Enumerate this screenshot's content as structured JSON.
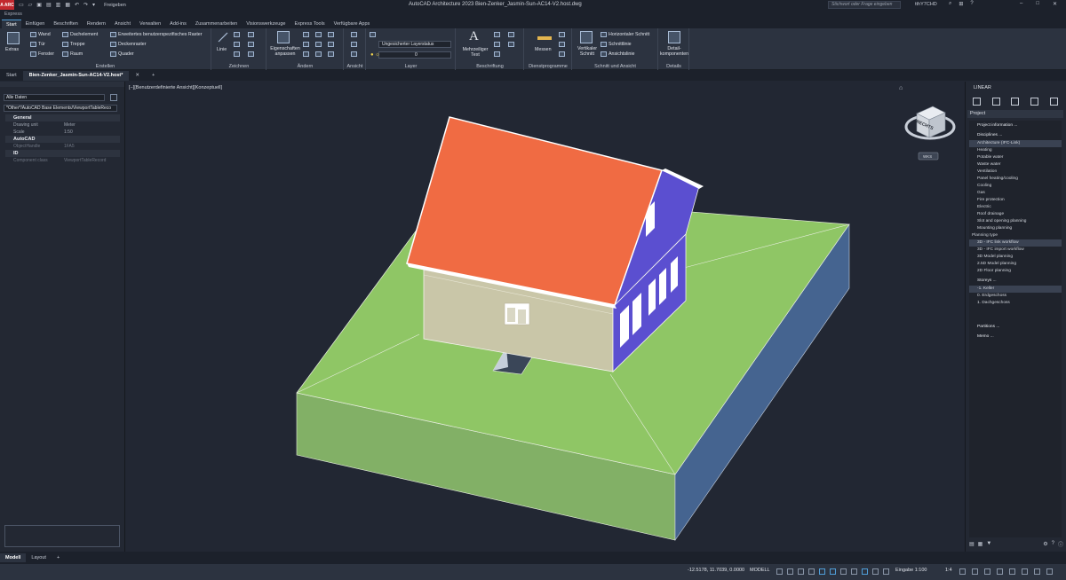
{
  "titlebar": {
    "logo": "A ARC",
    "share": "Freigeben",
    "title": "AutoCAD Architecture 2023   Bien-Zenker_Jasmin-Sun-AC14-V2.host.dwg",
    "search_placeholder": "Stichwort oder Frage eingeben",
    "user": "tthY7CHD"
  },
  "express": "Express",
  "ribbon_tabs": [
    "Start",
    "Einfügen",
    "Beschriften",
    "Rendern",
    "Ansicht",
    "Verwalten",
    "Add-ins",
    "Zusammenarbeiten",
    "Visionswerkzeuge",
    "Express Tools",
    "Verfügbare Apps"
  ],
  "ribbon": {
    "erstellen": {
      "label": "Erstellen",
      "extras": "Extras",
      "items": [
        "Wand",
        "Tür",
        "Fenster",
        "Dachelement",
        "Treppe",
        "Raum",
        "Erweitertes benutzerspezifisches Raster",
        "Deckenraster",
        "Quader"
      ]
    },
    "zeichnen": {
      "label": "Zeichnen",
      "linie": "Linie"
    },
    "aendern": {
      "label": "Ändern",
      "eigenschaften": "Eigenschaften anpassen"
    },
    "ansicht": {
      "label": "Ansicht"
    },
    "layer": {
      "label": "Layer",
      "layerstatus": "Ungesicherter Layerstatus",
      "current": "0"
    },
    "beschriftung": {
      "label": "Beschriftung",
      "mtext": "Mehrzeiliger Text"
    },
    "dienstprogramme": {
      "label": "Dienstprogramme",
      "messen": "Messen"
    },
    "schnitt": {
      "label": "Schnitt und Ansicht",
      "vertikal": "Vertikaler Schnitt",
      "horizontal": "Horizontaler Schnitt",
      "schnittlinie": "Schnittlinie",
      "ansichtslinie": "Ansichtslinie"
    },
    "details": {
      "label": "Details",
      "detail": "Detail-komponenten"
    }
  },
  "doc_tabs": [
    "Start",
    "Bien-Zenker_Jasmin-Sun-AC14-V2.host*"
  ],
  "left_palette": {
    "filter": "Alle Daten",
    "classification": "*Other*/AutoCAD Base Elements/ViewportTableReco",
    "categories": [
      {
        "name": "General",
        "rows": [
          [
            "Drawing unit",
            "Meter"
          ],
          [
            "Scale",
            "1:50"
          ]
        ]
      },
      {
        "name": "AutoCAD",
        "rows": [
          [
            "ObjectHandle",
            "1FA5"
          ]
        ]
      },
      {
        "name": "ID",
        "rows": [
          [
            "Component class",
            "ViewportTableRecord"
          ]
        ]
      }
    ]
  },
  "viewport": {
    "label": "[−][Benutzerdefinierte Ansicht][Konzeptuell]",
    "viewcube_face": "RECHTS",
    "wcs": "WKS"
  },
  "right_palette": {
    "title": "LINEAR",
    "project_label": "Project",
    "project_information": "Project information ...",
    "disciplines_label": "Disciplines ...",
    "disciplines": [
      "Architecture (IFC-Link)",
      "Heating",
      "Potable water",
      "Waste water",
      "Ventilation",
      "Panel heating/cooling",
      "Cooling",
      "Gas",
      "Fire protection",
      "Electric",
      "Roof drainage",
      "Slot and opening planning",
      "Mounting planning"
    ],
    "planning_type_label": "Planning type",
    "planning_types": [
      "3D - IFC link workflow",
      "3D - IFC import workflow",
      "3D Model planning",
      "2.5D Model planning",
      "2D Floor planning"
    ],
    "storeys_label": "Storeys ...",
    "storeys": [
      "-1. Keller",
      "0. Erdgeschoss",
      "1. Dachgeschoss"
    ],
    "partitions": "Partitions ...",
    "memo": "Memo ..."
  },
  "layout_tabs": [
    "Modell",
    "Layout"
  ],
  "statusbar": {
    "coords": "-12.5178, 11.7039, 0.0000",
    "mode": "MODELL",
    "scale": "Eingabe 1:100",
    "zoom": "1:4"
  },
  "colors": {
    "roof": "#f06b43",
    "wall_front": "#c9c6a8",
    "wall_side": "#5b4fd0",
    "terrain_top": "#8fc665",
    "terrain_side_front": "#82b066",
    "terrain_side_right": "#456490"
  }
}
